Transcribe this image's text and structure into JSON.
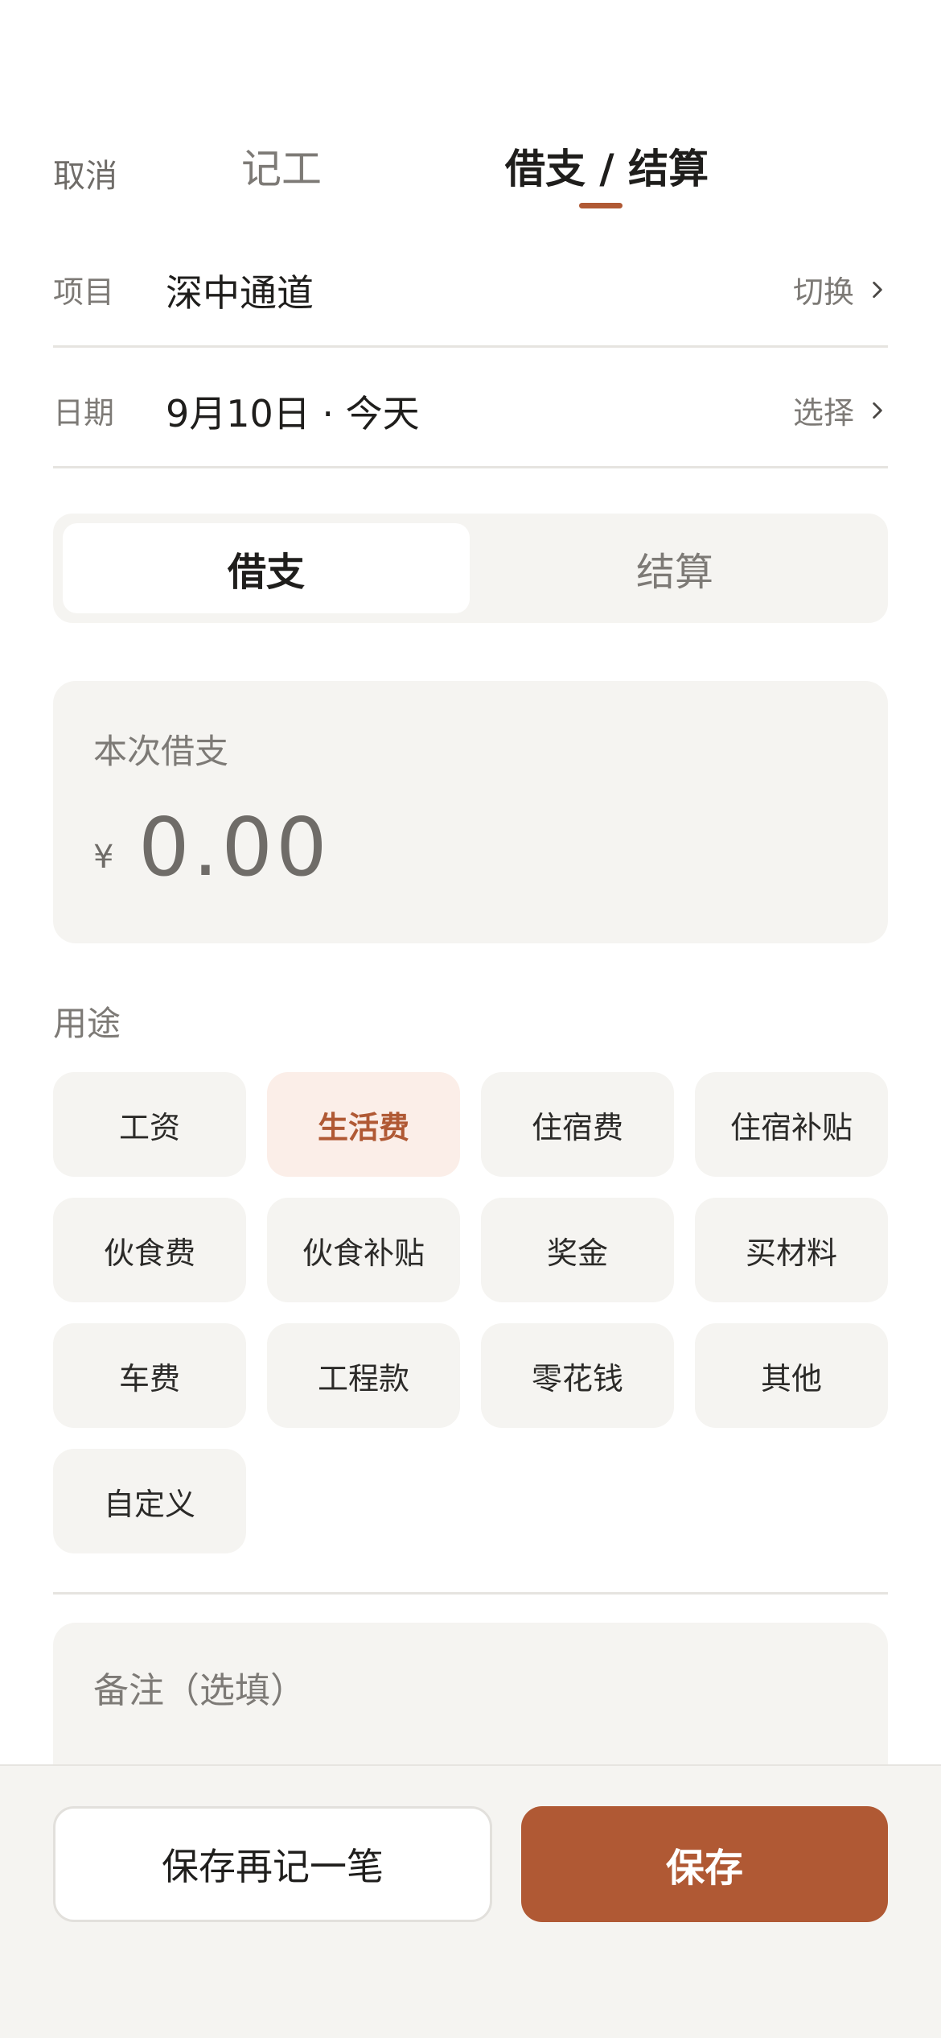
{
  "header": {
    "cancel_label": "取消",
    "tabs": [
      {
        "label": "记工",
        "active": false
      },
      {
        "label": "借支 / 结算",
        "active": true
      }
    ]
  },
  "rows": {
    "project": {
      "label": "项目",
      "value": "深中通道",
      "action": "切换"
    },
    "date": {
      "label": "日期",
      "value": "9月10日 · 今天",
      "action": "选择"
    }
  },
  "segment": {
    "options": [
      "借支",
      "结算"
    ],
    "selected": "借支"
  },
  "amount": {
    "label": "本次借支",
    "currency": "¥",
    "value": "0.00"
  },
  "purpose": {
    "title": "用途",
    "options": [
      "工资",
      "生活费",
      "住宿费",
      "住宿补贴",
      "伙食费",
      "伙食补贴",
      "奖金",
      "买材料",
      "车费",
      "工程款",
      "零花钱",
      "其他",
      "自定义"
    ],
    "selected": "生活费"
  },
  "note": {
    "placeholder": "备注（选填）"
  },
  "actions": {
    "save_another_label": "保存再记一笔",
    "save_label": "保存"
  },
  "colors": {
    "accent": "#b05934",
    "chip_active_bg": "#fbeee8",
    "surface": "#f5f4f1"
  }
}
